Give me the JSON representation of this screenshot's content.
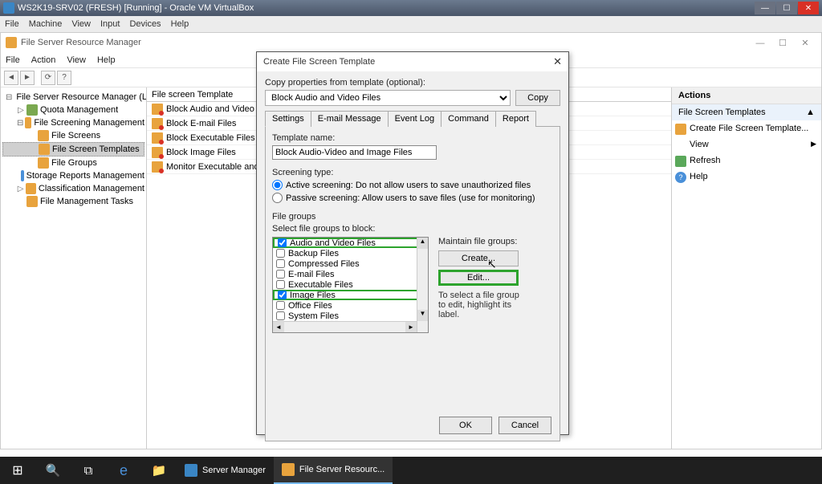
{
  "vm": {
    "title": "WS2K19-SRV02 (FRESH) [Running] - Oracle VM VirtualBox",
    "menu": [
      "File",
      "Machine",
      "View",
      "Input",
      "Devices",
      "Help"
    ]
  },
  "fsrm": {
    "title": "File Server Resource Manager",
    "menu": [
      "File",
      "Action",
      "View",
      "Help"
    ],
    "tree": {
      "root": "File Server Resource Manager (Local)",
      "quota": "Quota Management",
      "fsm": "File Screening Management",
      "fs": "File Screens",
      "fst": "File Screen Templates",
      "fg": "File Groups",
      "srm": "Storage Reports Management",
      "cm": "Classification Management",
      "fmt": "File Management Tasks"
    },
    "list": {
      "header": "File screen Template",
      "rows": [
        "Block Audio and Video Files",
        "Block E-mail Files",
        "Block Executable Files",
        "Block Image Files",
        "Monitor Executable and System Files"
      ]
    },
    "actions": {
      "header": "Actions",
      "section": "File Screen Templates",
      "items": {
        "create": "Create File Screen Template...",
        "refresh": "Refresh",
        "view": "View",
        "help": "Help"
      }
    }
  },
  "dialog": {
    "title": "Create File Screen Template",
    "copy_label": "Copy properties from template (optional):",
    "copy_value": "Block Audio and Video Files",
    "copy_btn": "Copy",
    "tabs": [
      "Settings",
      "E-mail Message",
      "Event Log",
      "Command",
      "Report"
    ],
    "tmpl_label": "Template name:",
    "tmpl_value": "Block Audio-Video and Image Files",
    "screen_label": "Screening type:",
    "active": "Active screening: Do not allow users to save unauthorized files",
    "passive": "Passive screening: Allow users to save files (use for monitoring)",
    "fg_label": "File groups",
    "fg_select": "Select file groups to block:",
    "fg_items": [
      {
        "label": "Audio and Video Files",
        "checked": true,
        "hl": true
      },
      {
        "label": "Backup Files",
        "checked": false,
        "hl": false
      },
      {
        "label": "Compressed Files",
        "checked": false,
        "hl": false
      },
      {
        "label": "E-mail Files",
        "checked": false,
        "hl": false
      },
      {
        "label": "Executable Files",
        "checked": false,
        "hl": false
      },
      {
        "label": "Image Files",
        "checked": true,
        "hl": true
      },
      {
        "label": "Office Files",
        "checked": false,
        "hl": false
      },
      {
        "label": "System Files",
        "checked": false,
        "hl": false
      }
    ],
    "maint_label": "Maintain file groups:",
    "create_btn": "Create...",
    "edit_btn": "Edit...",
    "maint_note": "To select a file group to edit, highlight its label.",
    "ok": "OK",
    "cancel": "Cancel"
  },
  "taskbar": {
    "sm": "Server Manager",
    "fsrm": "File Server Resourc..."
  }
}
